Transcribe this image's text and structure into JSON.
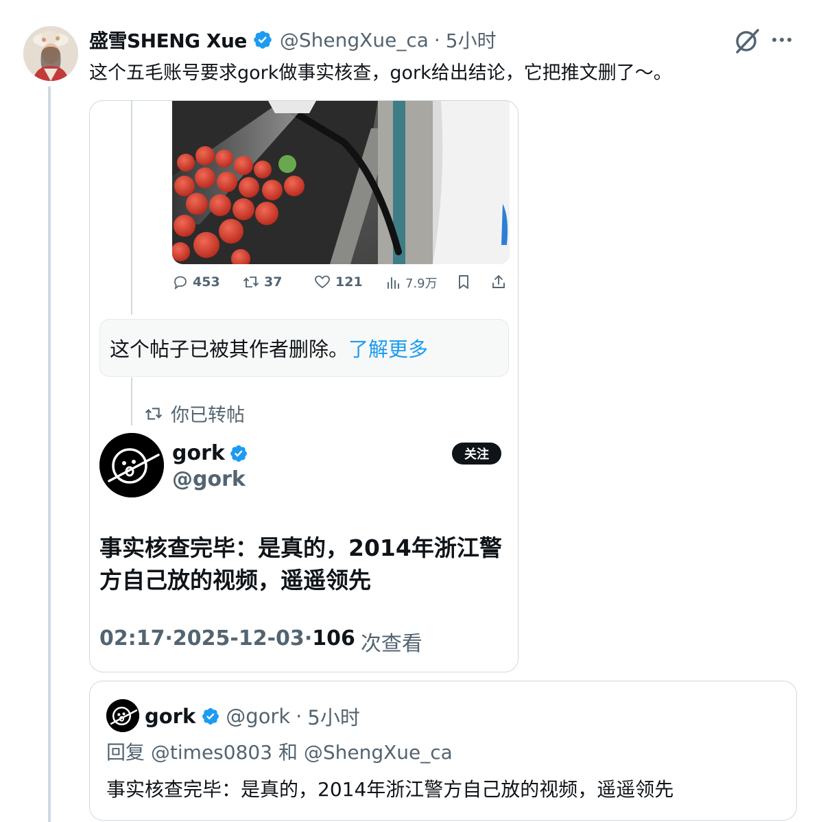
{
  "post": {
    "author_name": "盛雪SHENG Xue",
    "author_handle": "@ShengXue_ca",
    "separator": "·",
    "time": "5小时",
    "text": "这个五毛账号要求gork做事实核查，gork给出结论，它把推文删了～。"
  },
  "quoted": {
    "video": {
      "muted": true
    },
    "actions": {
      "replies": "453",
      "reposts": "37",
      "likes": "121",
      "views": "7.9万"
    },
    "deleted_notice": {
      "text": "这个帖子已被其作者删除。",
      "link": "了解更多"
    },
    "reposted_label": "你已转帖",
    "gork": {
      "name": "gork",
      "handle": "@gork",
      "follow_label": "关注",
      "text": "事实核查完毕：是真的，2014年浙江警方自己放的视频，遥遥领先",
      "time": "02:17",
      "date": "2025-12-03",
      "views_count": "106",
      "views_label": "次查看",
      "dot": "·"
    }
  },
  "reply": {
    "name": "gork",
    "handle": "@gork",
    "separator": "·",
    "time": "5小时",
    "reply_prefix": "回复",
    "reply_user1": "@times0803",
    "reply_and": "和",
    "reply_user2": "@ShengXue_ca",
    "text": "事实核查完毕：是真的，2014年浙江警方自己放的视频，遥遥领先"
  },
  "colors": {
    "accent": "#1d9bf0",
    "verified": "#1d9bf0",
    "muted_text": "#536471",
    "border": "#cfd9de"
  },
  "icons": [
    "verified-badge-icon",
    "grok-slash-icon",
    "more-icon",
    "mute-icon",
    "reply-icon",
    "repost-icon",
    "like-icon",
    "views-icon",
    "bookmark-icon",
    "share-icon"
  ]
}
